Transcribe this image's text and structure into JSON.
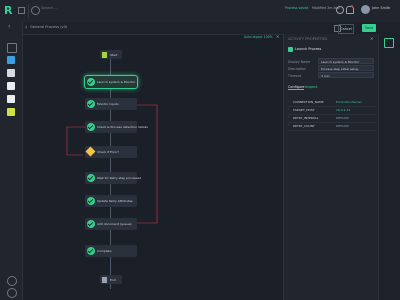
{
  "app": {
    "logo": "R"
  },
  "header": {
    "search_placeholder": "Search...",
    "status_label": "Process saved",
    "status_value": "Modified 3m ago",
    "user_name": "John Smith"
  },
  "breadcrumb": {
    "title": "General Process (v3)"
  },
  "canvas": {
    "tools_label": "Auto-layout  100%"
  },
  "flow": {
    "start": "Start",
    "end": "End",
    "decision": "Check if Error?",
    "nodes": [
      "Launch system & Monitor",
      "Monitor inputs",
      "Check & Process detection details",
      "Wait for Retry step processed",
      "Update Retry Attributes",
      "Add document (queue)",
      "Complete"
    ]
  },
  "toolbar": {
    "cancel_label": "Cancel",
    "save_label": "Save"
  },
  "panel": {
    "section_title": "ACTIVITY PROPERTIES",
    "activity_name": "Launch Process",
    "fields": [
      {
        "label": "Display Name",
        "value": "Launch system & Monitor"
      },
      {
        "label": "Description",
        "value": "Process step initial setup"
      },
      {
        "label": "Timeout",
        "value": "3 min"
      }
    ],
    "tabs": {
      "active": "Configure",
      "other": "Inspect"
    },
    "props": [
      {
        "name": "CONNECTION_NAME",
        "value": "ProductionServer"
      },
      {
        "name": "TARGET_HOST",
        "value": "10.0.4.12"
      },
      {
        "name": "RETRY_INTERVAL",
        "value": "DEFAULT"
      },
      {
        "name": "RETRY_COUNT",
        "value": "DEFAULT"
      }
    ]
  },
  "colors": {
    "accent": "#35d08f",
    "warning": "#f5c542",
    "loop": "#d9364a"
  }
}
